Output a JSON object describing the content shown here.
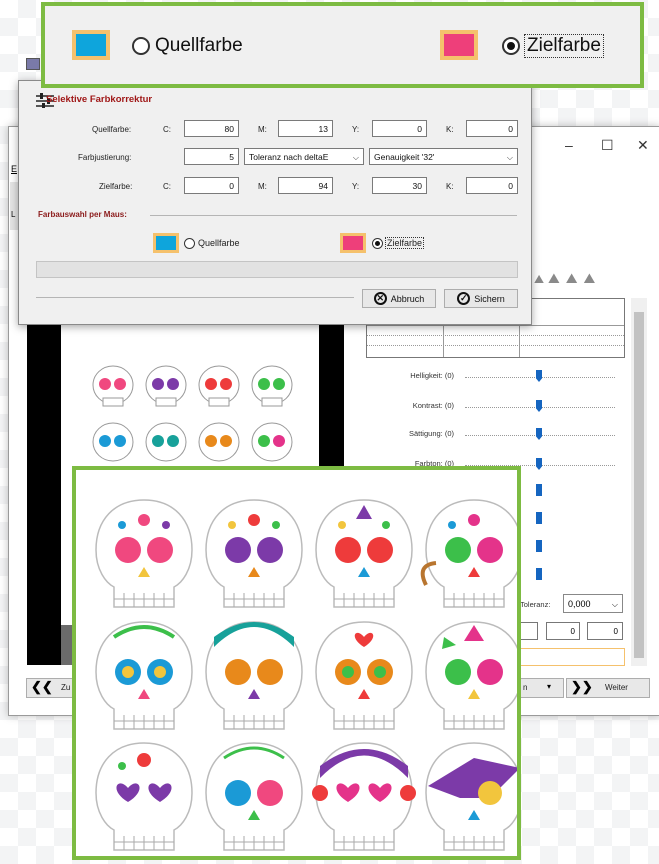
{
  "top_callout": {
    "source_label": "Quellfarbe",
    "target_label": "Zielfarbe",
    "source_color": "#0ea5dc",
    "target_color": "#ee3f7a"
  },
  "dialog": {
    "title": "Selektive Farbkorrektur",
    "quellfarbe": {
      "label": "Quellfarbe:",
      "C": "80",
      "M": "13",
      "Y": "0",
      "K": "0"
    },
    "zielfarbe": {
      "label": "Zielfarbe:",
      "C": "0",
      "M": "94",
      "Y": "30",
      "K": "0"
    },
    "farbjustierung": {
      "label": "Farbjustierung:",
      "value": "5",
      "method": "Toleranz nach deltaE",
      "precision": "Genauigkeit '32'"
    },
    "letters": {
      "c": "C:",
      "m": "M:",
      "y": "Y:",
      "k": "K:"
    },
    "mouse_section": "Farbauswahl per Maus:",
    "radio_source": "Quellfarbe",
    "radio_target": "Zielfarbe",
    "abort_label": "Abbruch",
    "save_label": "Sichern"
  },
  "back_window": {
    "sliders": [
      "Helligkeit: (0)",
      "Kontrast: (0)",
      "Sättigung: (0)",
      "Farbton: (0)"
    ],
    "toleranz_label": "Toleranz:",
    "toleranz_value": "0,000",
    "field_a": "0",
    "field_b": "0",
    "back_label": "Zu",
    "next_label": "Weiter",
    "mid_label": "n",
    "menu_letter": "E",
    "side_letter": "L"
  },
  "colors": {
    "callout_border": "#7dbb42",
    "swatch_border": "#f5c16c",
    "dialog_title": "#a01818"
  }
}
